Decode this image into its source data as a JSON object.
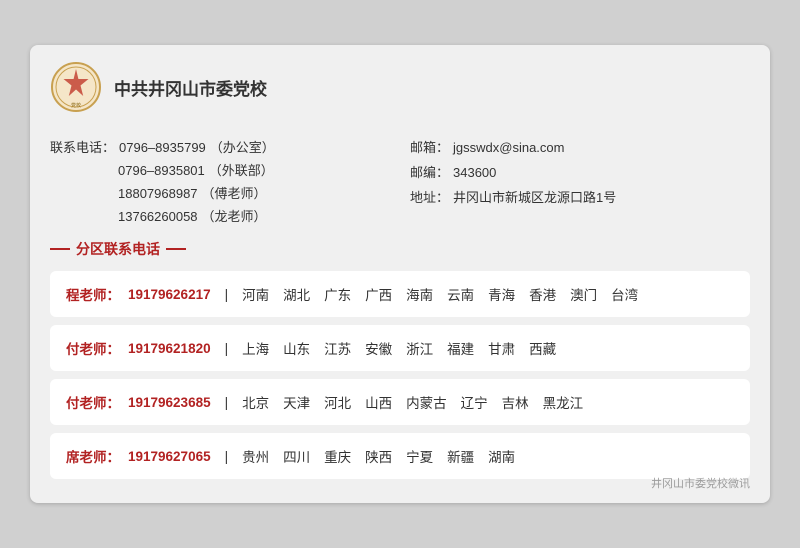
{
  "org": {
    "name": "中共井冈山市委党校",
    "logo_alt": "党校logo"
  },
  "contact": {
    "phone_label": "联系电话：",
    "phone1_value": "0796–8935799",
    "phone1_note": "（办公室）",
    "phone2_value": "0796–8935801",
    "phone2_note": "（外联部）",
    "phone3_value": "18807968987",
    "phone3_note": "（傅老师）",
    "phone4_value": "13766260058",
    "phone4_note": "（龙老师）",
    "email_label": "邮箱：",
    "email_value": "jgsswdx@sina.com",
    "zipcode_label": "邮编：",
    "zipcode_value": "343600",
    "address_label": "地址：",
    "address_value": "井冈山市新城区龙源口路1号"
  },
  "section_title": "分区联系电话",
  "regions": [
    {
      "teacher": "程老师：",
      "phone": "19179626217",
      "areas": [
        "河南",
        "湖北",
        "广东",
        "广西",
        "海南",
        "云南",
        "青海",
        "香港",
        "澳门",
        "台湾"
      ]
    },
    {
      "teacher": "付老师：",
      "phone": "19179621820",
      "areas": [
        "上海",
        "山东",
        "江苏",
        "安徽",
        "浙江",
        "福建",
        "甘肃",
        "西藏"
      ]
    },
    {
      "teacher": "付老师：",
      "phone": "19179623685",
      "areas": [
        "北京",
        "天津",
        "河北",
        "山西",
        "内蒙古",
        "辽宁",
        "吉林",
        "黑龙江"
      ]
    },
    {
      "teacher": "席老师：",
      "phone": "19179627065",
      "areas": [
        "贵州",
        "四川",
        "重庆",
        "陕西",
        "宁夏",
        "新疆",
        "湖南"
      ]
    }
  ],
  "watermark": "井冈山市委党校微讯"
}
